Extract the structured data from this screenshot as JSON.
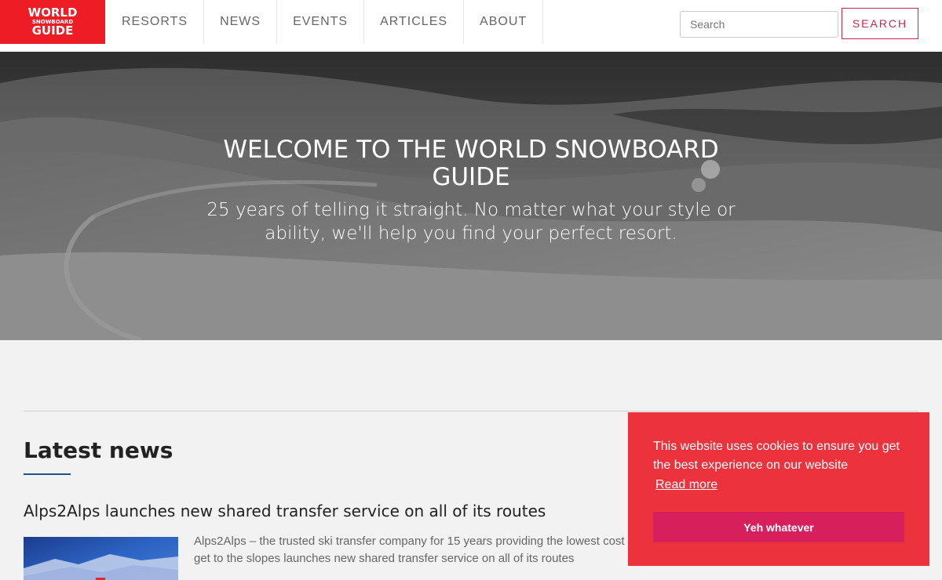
{
  "brand": {
    "line1": "WORLD",
    "line2": "SNOWBOARD",
    "line3": "GUIDE",
    "color": "#ee1c25"
  },
  "nav": {
    "items": [
      {
        "label": "RESORTS"
      },
      {
        "label": "NEWS"
      },
      {
        "label": "EVENTS"
      },
      {
        "label": "ARTICLES"
      },
      {
        "label": "ABOUT"
      }
    ]
  },
  "search": {
    "placeholder": "Search",
    "value": "",
    "button_label": "SEARCH",
    "accent": "#c8254c"
  },
  "hero": {
    "title": "WELCOME TO THE WORLD SNOWBOARD GUIDE",
    "subtitle": "25 years of telling it straight. No matter what your style or ability, we'll help you find your perfect resort."
  },
  "latest": {
    "heading": "Latest news",
    "underline_color": "#1f4e8c",
    "articles": [
      {
        "title": "Alps2Alps launches new shared transfer service on all of its routes",
        "excerpt": "Alps2Alps – the trusted ski transfer company for 15 years providing the lowest cost options to get to the slopes launches new shared transfer service on all of its routes"
      }
    ]
  },
  "cookie": {
    "message": "This website uses cookies to ensure you get the best experience on our website",
    "link_label": "Read more",
    "button_label": "Yeh whatever",
    "background": "#ec323d",
    "button_color": "#d61f5b"
  }
}
